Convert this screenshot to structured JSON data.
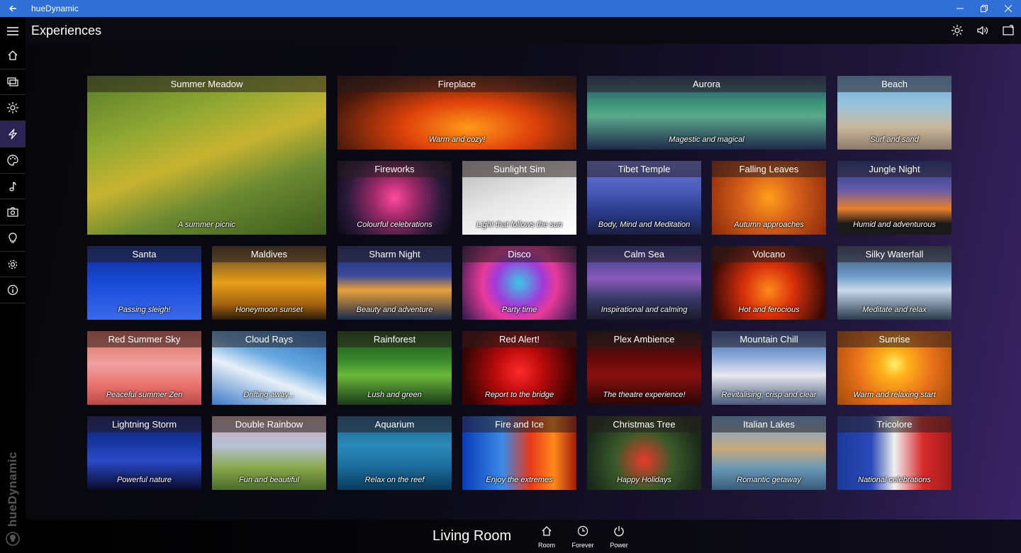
{
  "window": {
    "title": "hueDynamic"
  },
  "header": {
    "title": "Experiences"
  },
  "brand": "hueDynamic",
  "bottom": {
    "room": "Living Room",
    "buttons": [
      "Room",
      "Forever",
      "Power"
    ]
  },
  "tiles": [
    {
      "title": "Summer Meadow",
      "subtitle": "A summer picnic"
    },
    {
      "title": "Fireplace",
      "subtitle": "Warm and cozy!"
    },
    {
      "title": "Aurora",
      "subtitle": "Magestic and magical"
    },
    {
      "title": "Beach",
      "subtitle": "Surf and sand"
    },
    {
      "title": "Fireworks",
      "subtitle": "Colourful celebrations"
    },
    {
      "title": "Sunlight Sim",
      "subtitle": "Light that follows the sun"
    },
    {
      "title": "Tibet Temple",
      "subtitle": "Body, Mind and Meditation"
    },
    {
      "title": "Falling Leaves",
      "subtitle": "Autumn approaches"
    },
    {
      "title": "Jungle Night",
      "subtitle": "Humid and adventurous"
    },
    {
      "title": "Santa",
      "subtitle": "Passing sleigh!"
    },
    {
      "title": "Maldives",
      "subtitle": "Honeymoon sunset"
    },
    {
      "title": "Sharm Night",
      "subtitle": "Beauty and adventure"
    },
    {
      "title": "Disco",
      "subtitle": "Party time"
    },
    {
      "title": "Calm Sea",
      "subtitle": "Inspirational and calming"
    },
    {
      "title": "Volcano",
      "subtitle": "Hot and ferocious"
    },
    {
      "title": "Silky Waterfall",
      "subtitle": "Meditate and relax"
    },
    {
      "title": "Red Summer Sky",
      "subtitle": "Peaceful summer Zen"
    },
    {
      "title": "Cloud Rays",
      "subtitle": "Drifting away..."
    },
    {
      "title": "Rainforest",
      "subtitle": "Lush and green"
    },
    {
      "title": "Red Alert!",
      "subtitle": "Report to the bridge"
    },
    {
      "title": "Plex Ambience",
      "subtitle": "The theatre experience!"
    },
    {
      "title": "Mountain Chill",
      "subtitle": "Revitalising, crisp and clear"
    },
    {
      "title": "Sunrise",
      "subtitle": "Warm and relaxing start"
    },
    {
      "title": "Lightning Storm",
      "subtitle": "Powerful nature"
    },
    {
      "title": "Double Rainbow",
      "subtitle": "Fun and beautiful"
    },
    {
      "title": "Aquarium",
      "subtitle": "Relax on the reef"
    },
    {
      "title": "Fire and Ice",
      "subtitle": "Enjoy the extremes"
    },
    {
      "title": "Christmas Tree",
      "subtitle": "Happy Holidays"
    },
    {
      "title": "Italian Lakes",
      "subtitle": "Romantic getaway"
    },
    {
      "title": "Tricolore",
      "subtitle": "National celebrations"
    }
  ]
}
